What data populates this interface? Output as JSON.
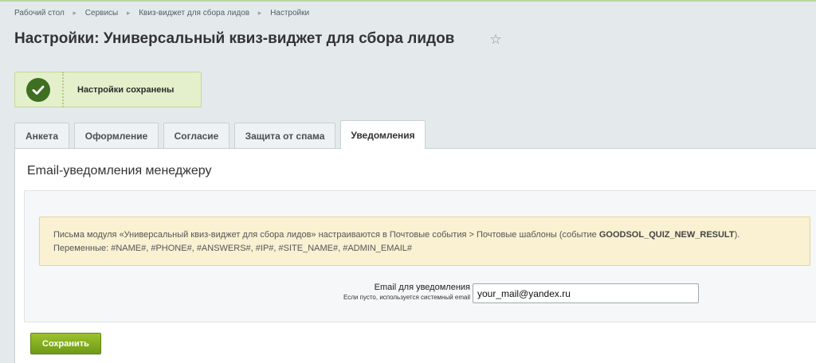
{
  "breadcrumb": [
    {
      "label": "Рабочий стол"
    },
    {
      "label": "Сервисы"
    },
    {
      "label": "Квиз-виджет для сбора лидов"
    },
    {
      "label": "Настройки"
    }
  ],
  "page_title": "Настройки: Универсальный квиз-виджет для сбора лидов",
  "notice": {
    "text": "Настройки сохранены"
  },
  "tabs": [
    {
      "label": "Анкета"
    },
    {
      "label": "Оформление"
    },
    {
      "label": "Согласие"
    },
    {
      "label": "Защита от спама"
    },
    {
      "label": "Уведомления",
      "active": true
    }
  ],
  "section": {
    "title": "Email-уведомления менеджеру",
    "info": {
      "line1_prefix": "Письма модуля «Универсальный квиз-виджет для сбора лидов» настраиваются в Почтовые события > Почтовые шаблоны (событие ",
      "event_code": "GOODSOL_QUIZ_NEW_RESULT",
      "line1_suffix": ").",
      "line2": "Переменные: #NAME#, #PHONE#, #ANSWERS#, #IP#, #SITE_NAME#, #ADMIN_EMAIL#"
    },
    "email_field": {
      "label": "Email для уведомления",
      "hint": "Если пусто, используется системный email",
      "value": "your_mail@yandex.ru"
    }
  },
  "save_button": {
    "label": "Сохранить"
  },
  "colors": {
    "accent_green": "#7aa21b",
    "notice_bg": "#e4efcb",
    "info_bg": "#f9f1d1"
  }
}
